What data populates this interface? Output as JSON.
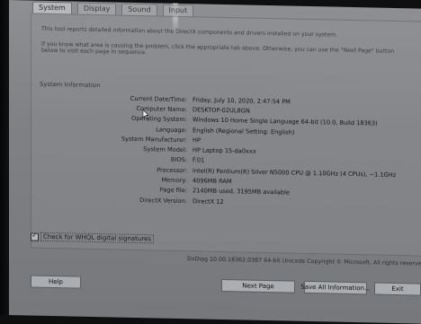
{
  "tabs": [
    {
      "label": "System",
      "active": true
    },
    {
      "label": "Display",
      "active": false
    },
    {
      "label": "Sound",
      "active": false
    },
    {
      "label": "Input",
      "active": false
    }
  ],
  "intro": {
    "line1": "This tool reports detailed information about the DirectX components and drivers installed on your system.",
    "line2": "If you know what area is causing the problem, click the appropriate tab above. Otherwise, you can use the \"Next Page\" button below to visit each page in sequence."
  },
  "system_information": {
    "title": "System Information",
    "rows": [
      {
        "label": "Current Date/Time:",
        "value": "Friday, July 10, 2020, 2:47:54 PM"
      },
      {
        "label": "Computer Name:",
        "value": "DESKTOP-02UL8GN"
      },
      {
        "label": "Operating System:",
        "value": "Windows 10 Home Single Language 64-bit (10.0, Build 18363)"
      },
      {
        "label": "Language:",
        "value": "English (Regional Setting: English)"
      },
      {
        "label": "System Manufacturer:",
        "value": "HP"
      },
      {
        "label": "System Model:",
        "value": "HP Laptop 15-da0xxx"
      },
      {
        "label": "BIOS:",
        "value": "F.01"
      },
      {
        "label": "Processor:",
        "value": "Intel(R) Pentium(R) Silver N5000 CPU @ 1.10GHz (4 CPUs), ~1.1GHz"
      },
      {
        "label": "Memory:",
        "value": "4096MB RAM"
      },
      {
        "label": "Page file:",
        "value": "2140MB used, 3195MB available"
      },
      {
        "label": "DirectX Version:",
        "value": "DirectX 12"
      }
    ]
  },
  "whql": {
    "label": "Check for WHQL digital signatures",
    "checked": true
  },
  "footer": {
    "version_text": "DxDiag 10.00.18362.0387 64-bit Unicode  Copyright © Microsoft. All rights reserved."
  },
  "buttons": {
    "help": "Help",
    "next": "Next Page",
    "save": "Save All Information...",
    "exit": "Exit"
  },
  "icons": {
    "cursor": "mouse-pointer-icon",
    "check": "checkmark-icon"
  }
}
